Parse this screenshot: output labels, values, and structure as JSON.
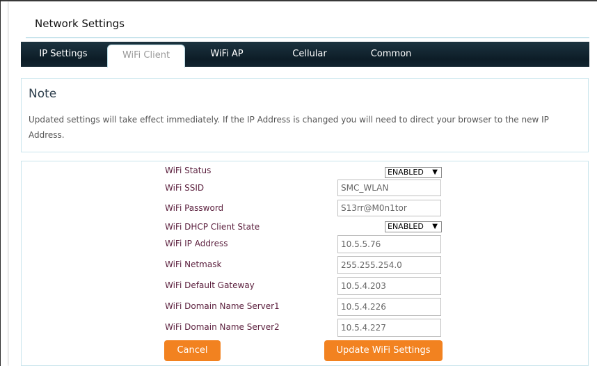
{
  "page": {
    "title": "Network Settings"
  },
  "tabs": [
    {
      "label": "IP Settings",
      "active": false
    },
    {
      "label": "WiFi Client",
      "active": true
    },
    {
      "label": "WiFi AP",
      "active": false
    },
    {
      "label": "Cellular",
      "active": false
    },
    {
      "label": "Common",
      "active": false
    }
  ],
  "note": {
    "title": "Note",
    "text": "Updated settings will take effect immediately. If the IP Address is changed you will need to direct your browser to the new IP Address."
  },
  "form": {
    "wifi_status": {
      "label": "WiFi Status",
      "value": "ENABLED"
    },
    "wifi_ssid": {
      "label": "WiFi SSID",
      "value": "SMC_WLAN"
    },
    "wifi_password": {
      "label": "WiFi Password",
      "value": "S13rr@M0n1tor"
    },
    "dhcp_state": {
      "label": "WiFi DHCP Client State",
      "value": "ENABLED"
    },
    "ip_address": {
      "label": "WiFi IP Address",
      "value": "10.5.5.76"
    },
    "netmask": {
      "label": "WiFi Netmask",
      "value": "255.255.254.0"
    },
    "gateway": {
      "label": "WiFi Default Gateway",
      "value": "10.5.4.203"
    },
    "dns1": {
      "label": "WiFi Domain Name Server1",
      "value": "10.5.4.226"
    },
    "dns2": {
      "label": "WiFi Domain Name Server2",
      "value": "10.5.4.227"
    },
    "dropdown_arrow": "▼"
  },
  "buttons": {
    "cancel": "Cancel",
    "update": "Update WiFi Settings"
  },
  "colors": {
    "accent_orange": "#f28220",
    "tabbar_dark": "#0d1d27",
    "border_light_blue": "#c8e4ec",
    "label_maroon": "#5a1e3c"
  }
}
